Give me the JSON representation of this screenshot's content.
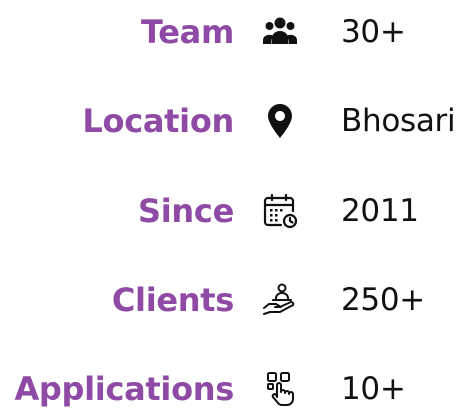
{
  "stats": [
    {
      "label": "Team",
      "icon": "team-icon",
      "value": "30+"
    },
    {
      "label": "Location",
      "icon": "location-pin-icon",
      "value": "Bhosari"
    },
    {
      "label": "Since",
      "icon": "calendar-clock-icon",
      "value": "2011"
    },
    {
      "label": "Clients",
      "icon": "hand-person-icon",
      "value": "250+"
    },
    {
      "label": "Applications",
      "icon": "touch-apps-icon",
      "value": "10+"
    }
  ],
  "colors": {
    "label": "#8e4aa4",
    "value": "#111111",
    "icon": "#111111"
  }
}
